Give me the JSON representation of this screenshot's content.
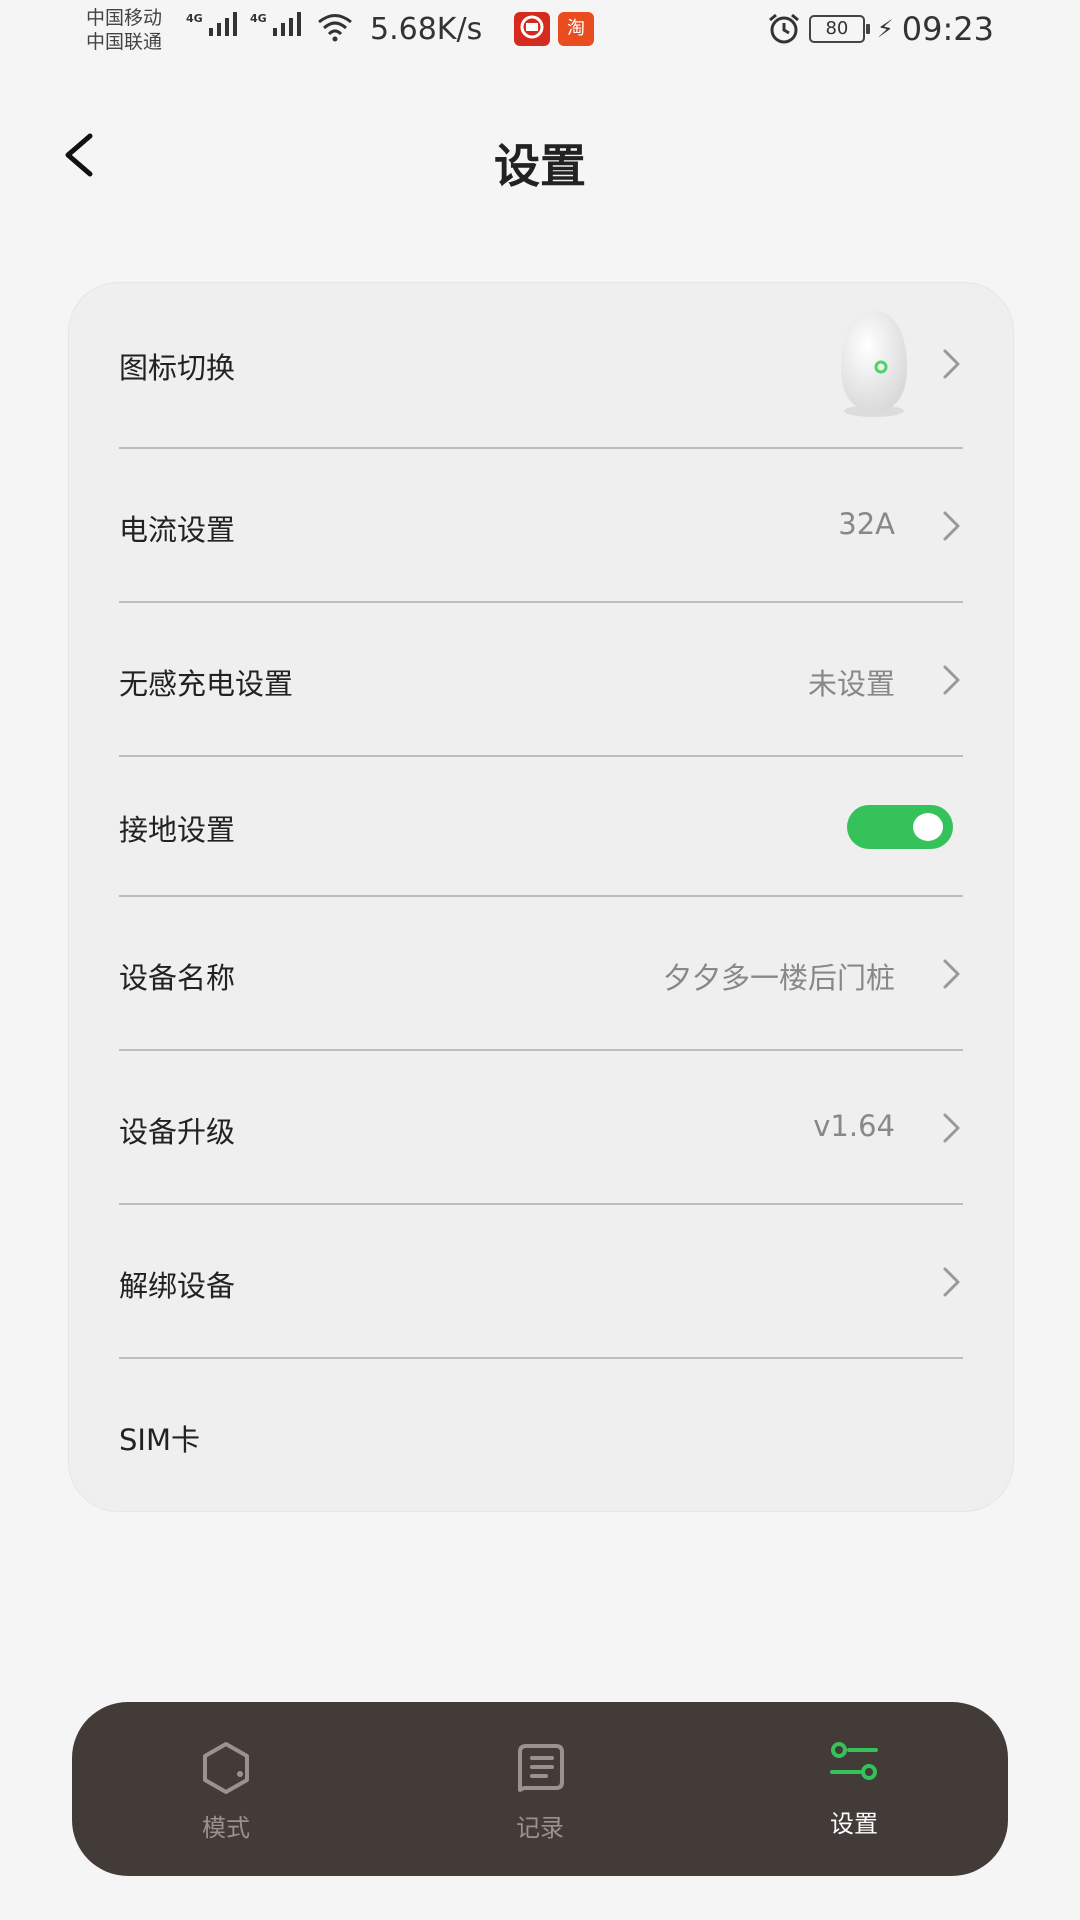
{
  "status_bar": {
    "carrier_1": "中国移动",
    "carrier_2": "中国联通",
    "network_1": "4G",
    "network_2": "4G",
    "net_speed": "5.68K/s",
    "app_badge_2": "淘",
    "battery": "80",
    "time": "09:23",
    "icons": [
      "signal-icon",
      "wifi-icon",
      "app-badge-icon",
      "alarm-icon",
      "battery-icon",
      "charging-icon"
    ]
  },
  "header": {
    "title": "设置",
    "back_icon": "chevron-left-icon"
  },
  "settings": {
    "items": [
      {
        "label": "图标切换",
        "value": "",
        "type": "image"
      },
      {
        "label": "电流设置",
        "value": "32A",
        "type": "link"
      },
      {
        "label": "无感充电设置",
        "value": "未设置",
        "type": "link"
      },
      {
        "label": "接地设置",
        "value": "",
        "type": "toggle",
        "on": true
      },
      {
        "label": "设备名称",
        "value": "夕夕多一楼后门桩",
        "type": "link"
      },
      {
        "label": "设备升级",
        "value": "v1.64",
        "type": "link"
      },
      {
        "label": "解绑设备",
        "value": "",
        "type": "link"
      },
      {
        "label": "SIM卡",
        "value": "",
        "type": "static"
      }
    ]
  },
  "bottom_nav": {
    "items": [
      {
        "label": "模式",
        "icon": "mode-hexagon-icon",
        "active": false
      },
      {
        "label": "记录",
        "icon": "record-list-icon",
        "active": false
      },
      {
        "label": "设置",
        "icon": "settings-sliders-icon",
        "active": true
      }
    ]
  },
  "colors": {
    "accent": "#35c25a",
    "nav_background": "#433b38",
    "card_background": "#efefef",
    "page_background": "#f5f5f5"
  }
}
